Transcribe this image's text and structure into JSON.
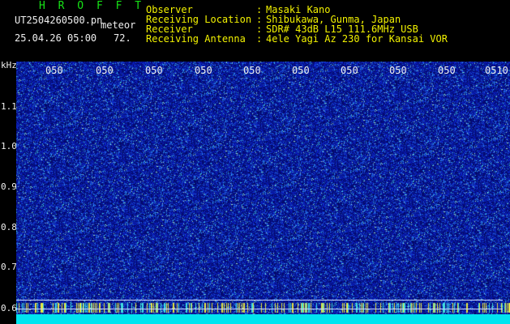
{
  "header": {
    "brand": "H R O F F T",
    "filename": "UT2504260500.pn",
    "kind": "meteor",
    "timestamp": "25.04.26 05:00",
    "number": "72.",
    "meta": [
      {
        "label": "Observer",
        "value": "Masaki Kano"
      },
      {
        "label": "Receiving Location",
        "value": "Shibukawa, Gunma, Japan"
      },
      {
        "label": "Receiver",
        "value": "SDR# 43dB L15 111.6MHz USB"
      },
      {
        "label": "Receiving Antenna",
        "value": "4ele Yagi Az 230 for Kansai VOR"
      }
    ],
    "separator": ":"
  },
  "axes": {
    "y_unit": "kHz",
    "y_ticks": [
      "1.1",
      "1.0",
      "0.9",
      "0.8",
      "0.7",
      "0.6"
    ],
    "x_ticks": [
      "050",
      "050",
      "050",
      "050",
      "050",
      "050",
      "050",
      "050",
      "050",
      "0510"
    ]
  },
  "colors": {
    "background": "#000000",
    "waterfall_base": "#0a1a8a",
    "brand_text": "#17e317",
    "meta_text": "#f2f200",
    "axis_text": "#f0f0f0",
    "noise_band": "#00e5f0"
  }
}
